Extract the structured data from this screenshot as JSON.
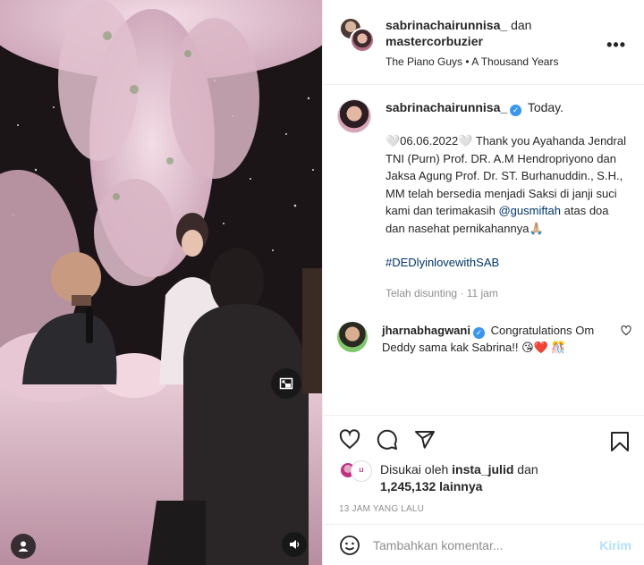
{
  "header": {
    "user1": "sabrinachairunnisa_",
    "conjunction": "dan",
    "user2": "mastercorbuzier",
    "audio": "The Piano Guys • A Thousand Years",
    "more_icon": "more-horizontal-icon"
  },
  "caption": {
    "username": "sabrinachairunnisa_",
    "first_line": "Today.",
    "text_before_mention": "🤍06.06.2022🤍 Thank you Ayahanda Jendral TNI (Purn) Prof. DR. A.M Hendropriyono dan Jaksa Agung Prof. Dr. ST. Burhanuddin., S.H., MM telah bersedia menjadi Saksi di janji suci kami dan terimakasih",
    "mention": "@gusmiftah",
    "text_after_mention": "atas doa dan nasehat pernikahannya🙏🏼",
    "hashtag": "#DEDlyinlovewithSAB",
    "edited": "Telah disunting · 11 jam"
  },
  "comment": {
    "username": "jharnabhagwani",
    "text": "Congratulations Om Deddy sama kak Sabrina!! 😘❤️ 🎊"
  },
  "likes": {
    "prefix": "Disukai oleh",
    "liker": "insta_julid",
    "conj": "dan",
    "count": "1,245,132 lainnya"
  },
  "time": "13 JAM YANG LALU",
  "add_comment": {
    "placeholder": "Tambahkan komentar...",
    "post_label": "Kirim"
  },
  "colors": {
    "link": "#00376b",
    "verified": "#3897f0",
    "post_disabled": "#b2dffc",
    "muted": "#8e8e8e"
  }
}
